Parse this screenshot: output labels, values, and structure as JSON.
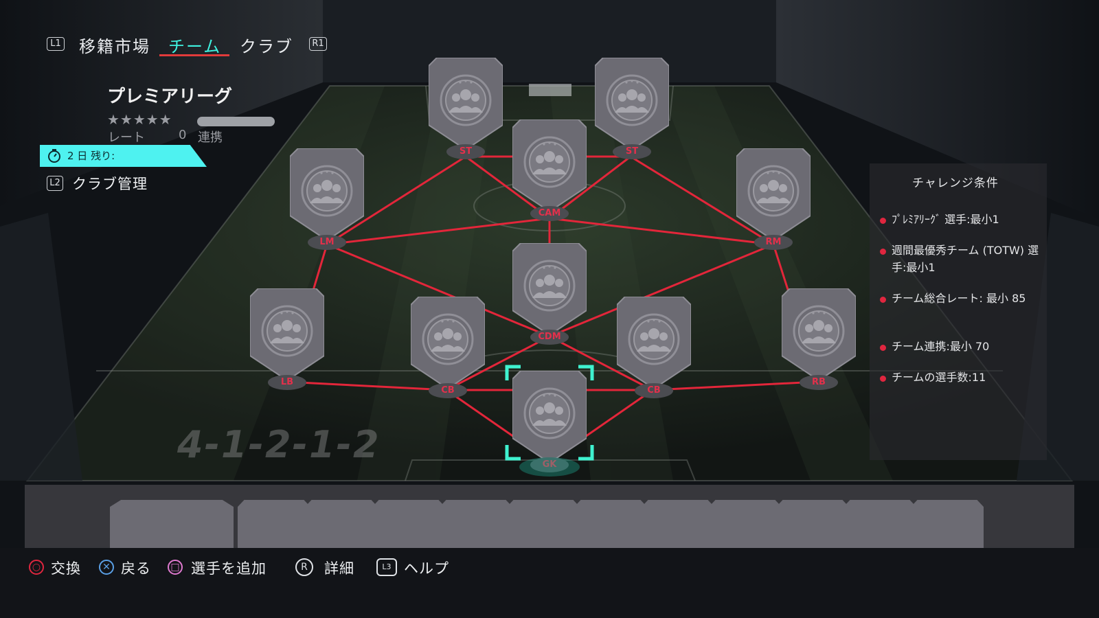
{
  "nav": {
    "l1": "L1",
    "tabs": [
      {
        "label": "移籍市場",
        "active": false
      },
      {
        "label": "チーム",
        "active": true
      },
      {
        "label": "クラブ",
        "active": false
      }
    ],
    "r1": "R1"
  },
  "squad": {
    "name": "プレミアリーグ",
    "rating_label": "レート",
    "rating_value": "0",
    "chemistry_label": "連携",
    "star_count": 5
  },
  "timer": {
    "text": "2 日 残り:"
  },
  "club_mgmt": {
    "key": "L2",
    "label": "クラブ管理"
  },
  "formation": "4-1-2-1-2",
  "positions": [
    {
      "id": "st-left",
      "label": "ST"
    },
    {
      "id": "st-right",
      "label": "ST"
    },
    {
      "id": "cam",
      "label": "CAM"
    },
    {
      "id": "lm",
      "label": "LM"
    },
    {
      "id": "rm",
      "label": "RM"
    },
    {
      "id": "cdm",
      "label": "CDM"
    },
    {
      "id": "lb",
      "label": "LB"
    },
    {
      "id": "cb-left",
      "label": "CB"
    },
    {
      "id": "cb-right",
      "label": "CB"
    },
    {
      "id": "rb",
      "label": "RB"
    },
    {
      "id": "gk",
      "label": "GK",
      "selected": true
    }
  ],
  "challenge": {
    "title": "チャレンジ条件",
    "requirements": [
      "ﾌﾟﾚﾐｱﾘｰｸﾞ 選手:最小1",
      "週間最優秀チーム (TOTW) 選手:最小1",
      "チーム総合レート: 最小 85",
      "チーム連携:最小 70",
      "チームの選手数:11"
    ]
  },
  "footer": {
    "swap": "交換",
    "back": "戻る",
    "add_player": "選手を追加",
    "r_key": "R",
    "details": "詳細",
    "l3_key": "L3",
    "help": "ヘルプ"
  },
  "colors": {
    "accent_cyan": "#3ff2e0",
    "link_red": "#e3263a",
    "card_gray": "#6c6b73",
    "req_dot": "#e0263f"
  }
}
